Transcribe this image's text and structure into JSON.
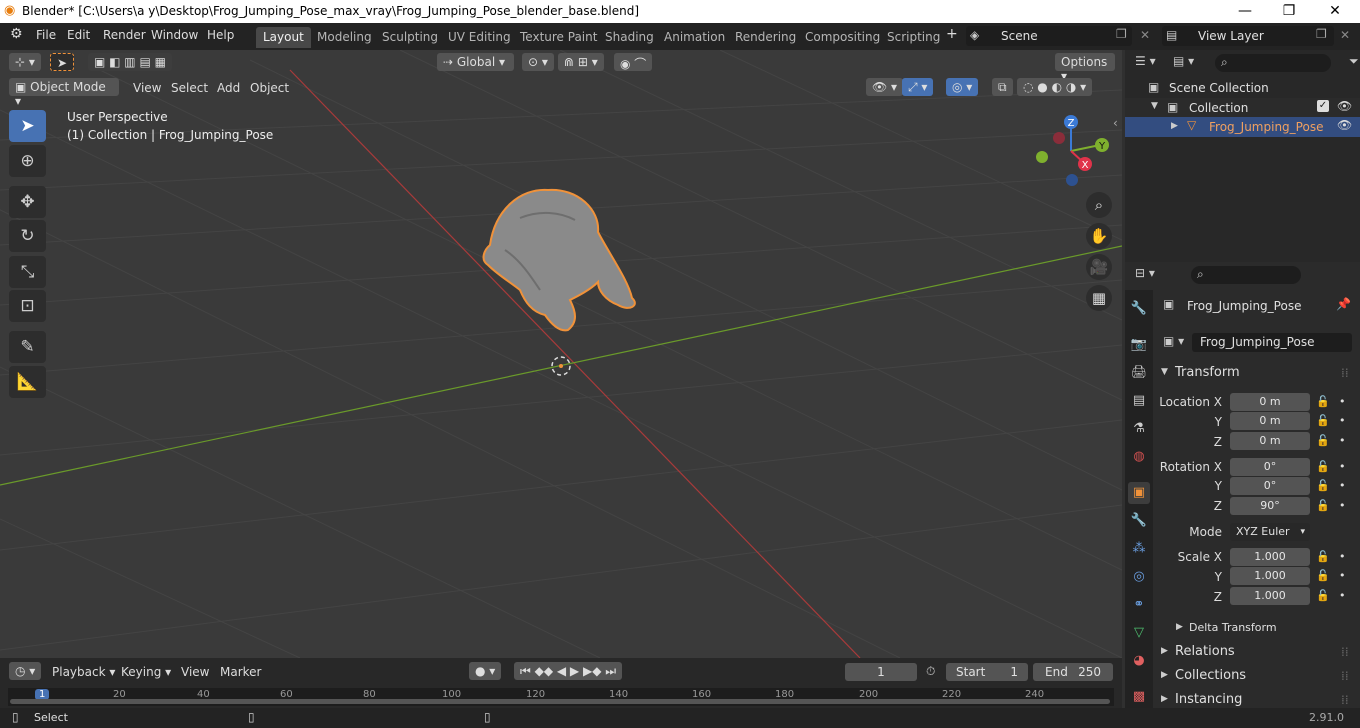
{
  "titlebar": {
    "title": "Blender* [C:\\Users\\a y\\Desktop\\Frog_Jumping_Pose_max_vray\\Frog_Jumping_Pose_blender_base.blend]",
    "minimize": "—",
    "maximize": "❐",
    "close": "✕"
  },
  "menu": {
    "file": "File",
    "edit": "Edit",
    "render": "Render",
    "window": "Window",
    "help": "Help"
  },
  "workspaces": [
    "Layout",
    "Modeling",
    "Sculpting",
    "UV Editing",
    "Texture Paint",
    "Shading",
    "Animation",
    "Rendering",
    "Compositing",
    "Scripting"
  ],
  "scene": {
    "label": "Scene",
    "view_layer": "View Layer"
  },
  "viewport_header": {
    "orientation": "Global",
    "options": "Options",
    "mode": "Object Mode",
    "view": "View",
    "select": "Select",
    "add": "Add",
    "object": "Object"
  },
  "viewport": {
    "perspective": "User Perspective",
    "collection_info": "(1) Collection | Frog_Jumping_Pose"
  },
  "gizmo": {
    "x": "X",
    "y": "Y",
    "z": "Z"
  },
  "outliner": {
    "scene_collection": "Scene Collection",
    "collection": "Collection",
    "object": "Frog_Jumping_Pose"
  },
  "properties": {
    "object_name": "Frog_Jumping_Pose",
    "data_name": "Frog_Jumping_Pose",
    "transform_title": "Transform",
    "location_x_label": "Location X",
    "y_label": "Y",
    "z_label": "Z",
    "location": [
      "0 m",
      "0 m",
      "0 m"
    ],
    "rotation_x_label": "Rotation X",
    "rotation": [
      "0°",
      "0°",
      "90°"
    ],
    "mode_label": "Mode",
    "mode_value": "XYZ Euler",
    "scale_x_label": "Scale X",
    "scale": [
      "1.000",
      "1.000",
      "1.000"
    ],
    "delta": "Delta Transform",
    "relations": "Relations",
    "collections": "Collections",
    "instancing": "Instancing"
  },
  "timeline": {
    "playback": "Playback",
    "keying": "Keying",
    "view": "View",
    "marker": "Marker",
    "current_frame": "1",
    "start_label": "Start",
    "start": "1",
    "end_label": "End",
    "end": "250",
    "ticks": [
      "1",
      "20",
      "40",
      "60",
      "80",
      "100",
      "120",
      "140",
      "160",
      "180",
      "200",
      "220",
      "240"
    ]
  },
  "status": {
    "select": "Select",
    "version": "2.91.0"
  },
  "colors": {
    "accent": "#4772b3",
    "selection": "#f0923a",
    "x_axis": "#a83a3a",
    "y_axis": "#6a9a2a"
  }
}
